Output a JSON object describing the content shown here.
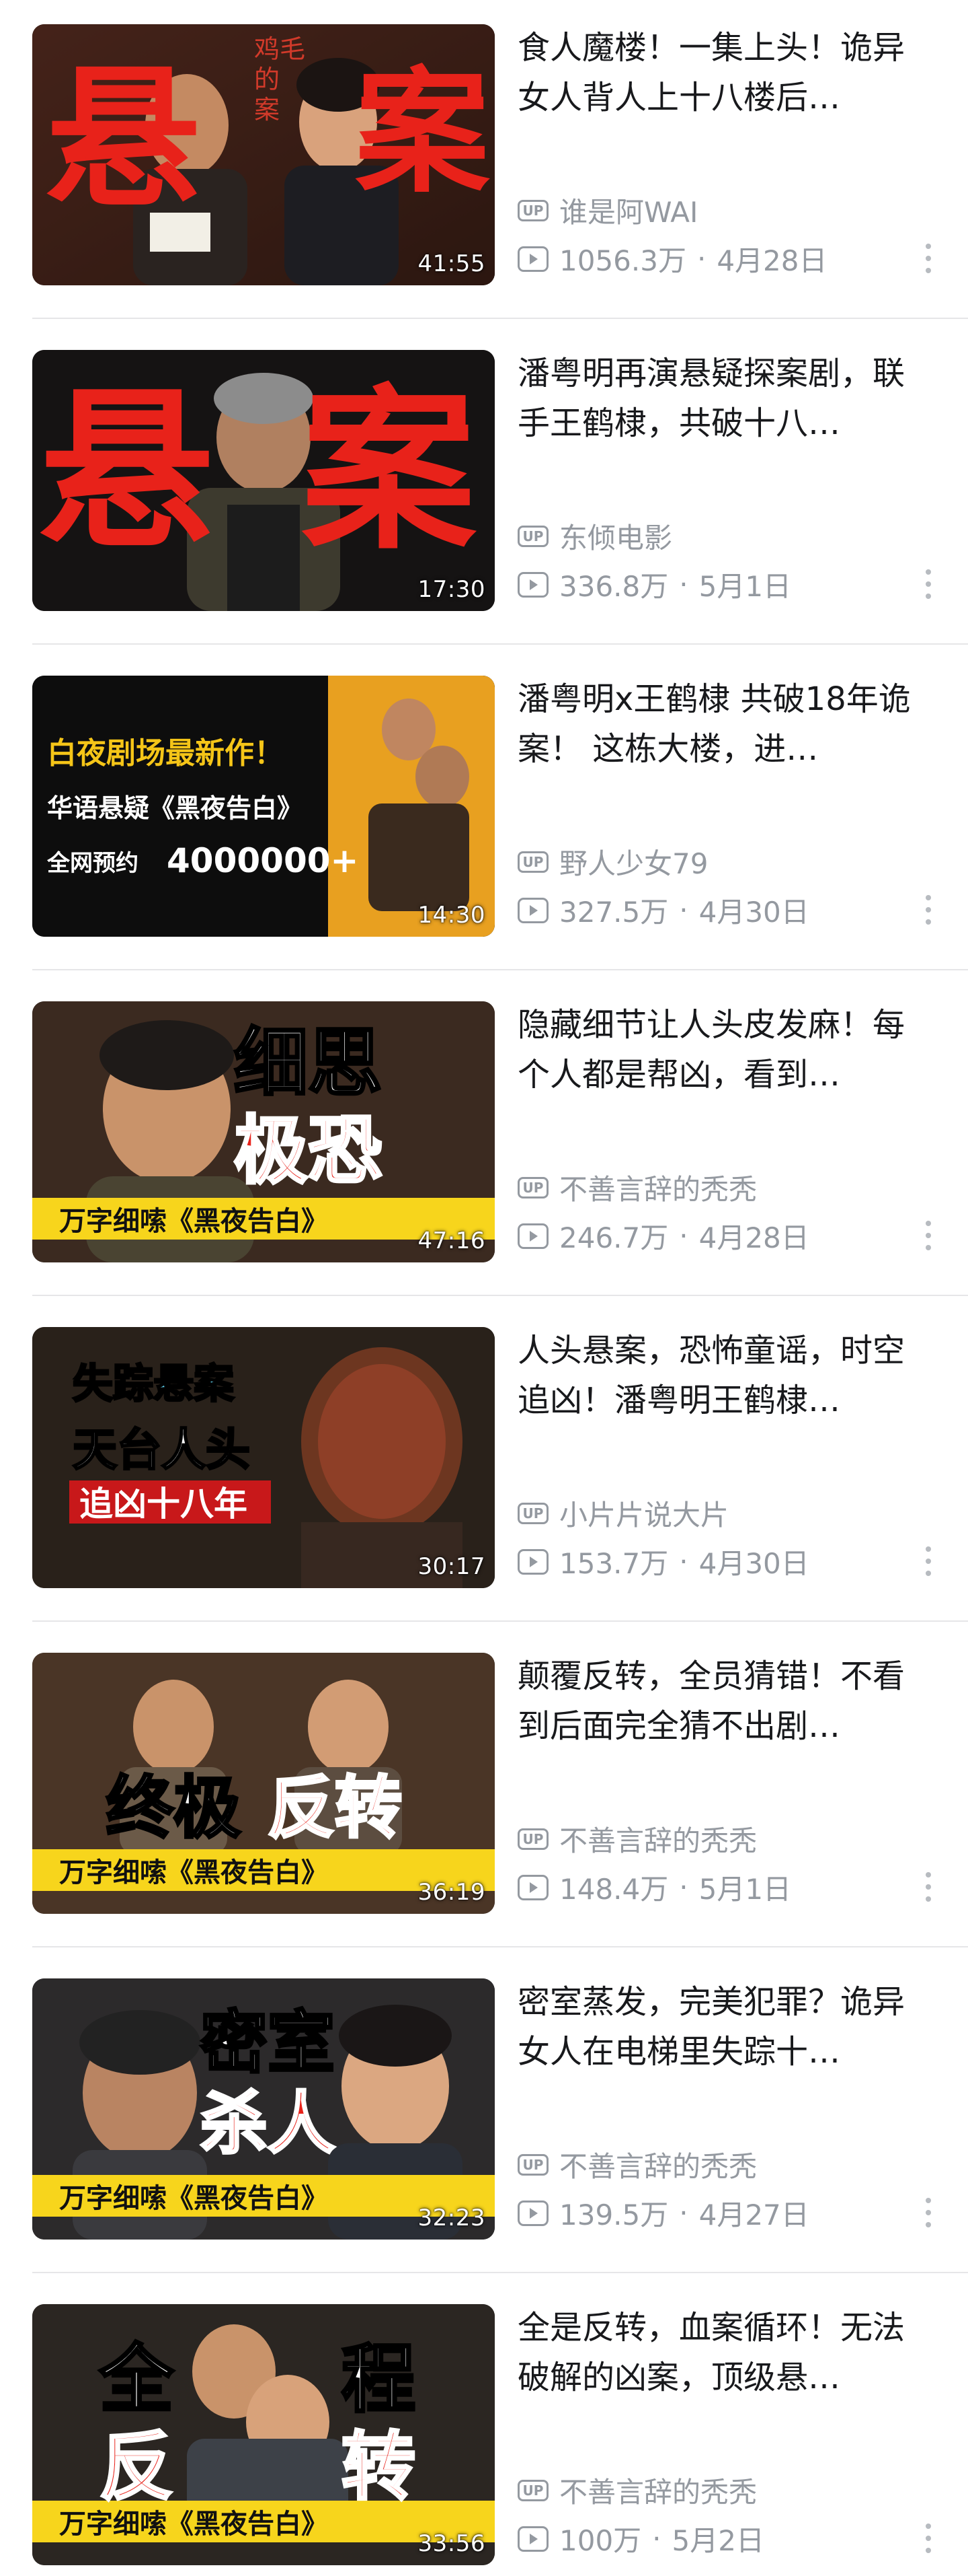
{
  "feed": [
    {
      "title": "食人魔楼！一集上头！诡异女人背人上十八楼后…",
      "uploader": "谁是阿WAI",
      "views": "1056.3万",
      "date": "4月28日",
      "duration": "41:55",
      "thumb_text": [
        "悬",
        "案"
      ],
      "thumb_small_text": [
        "鸡毛",
        "的",
        "案"
      ]
    },
    {
      "title": "潘粤明再演悬疑探案剧，联手王鹤棣，共破十八…",
      "uploader": "东倾电影",
      "views": "336.8万",
      "date": "5月1日",
      "duration": "17:30",
      "thumb_text": [
        "悬",
        "案"
      ]
    },
    {
      "title": "潘粤明x王鹤棣 共破18年诡案！ 这栋大楼，进…",
      "uploader": "野人少女79",
      "views": "327.5万",
      "date": "4月30日",
      "duration": "14:30",
      "thumb_text": [
        "白夜剧场最新作！",
        "华语悬疑《黑夜告白》",
        "全网预约",
        "4000000+"
      ]
    },
    {
      "title": "隐藏细节让人头皮发麻！每个人都是帮凶，看到…",
      "uploader": "不善言辞的秃秃",
      "views": "246.7万",
      "date": "4月28日",
      "duration": "47:16",
      "thumb_text": [
        "细思",
        "极恐",
        "万字细嗦《黑夜告白》"
      ]
    },
    {
      "title": "人头悬案，恐怖童谣，时空追凶！潘粤明王鹤棣…",
      "uploader": "小片片说大片",
      "views": "153.7万",
      "date": "4月30日",
      "duration": "30:17",
      "thumb_text": [
        "失踪悬案",
        "天台人头",
        "追凶十八年"
      ]
    },
    {
      "title": "颠覆反转，全员猜错！不看到后面完全猜不出剧…",
      "uploader": "不善言辞的秃秃",
      "views": "148.4万",
      "date": "5月1日",
      "duration": "36:19",
      "thumb_text": [
        "终极",
        "反转",
        "万字细嗦《黑夜告白》"
      ]
    },
    {
      "title": "密室蒸发，完美犯罪？诡异女人在电梯里失踪十…",
      "uploader": "不善言辞的秃秃",
      "views": "139.5万",
      "date": "4月27日",
      "duration": "32:23",
      "thumb_text": [
        "密室",
        "杀人",
        "万字细嗦《黑夜告白》"
      ]
    },
    {
      "title": "全是反转，血案循环！无法破解的凶案，顶级悬…",
      "uploader": "不善言辞的秃秃",
      "views": "100万",
      "date": "5月2日",
      "duration": "33:56",
      "thumb_text": [
        "全",
        "程",
        "反",
        "转",
        "万字细嗦《黑夜告白》"
      ]
    }
  ],
  "labels": {
    "up_badge": "UP",
    "separator": "·"
  },
  "colors": {
    "meta_gray": "#9499a0",
    "title_text": "#18191c",
    "thumb_red": "#e8221a",
    "thumb_yellow": "#f7d51c",
    "divider": "#e6e6e8"
  },
  "icons": {
    "uploader": "up-badge-icon",
    "views": "play-count-icon",
    "more": "more-vertical-icon"
  }
}
